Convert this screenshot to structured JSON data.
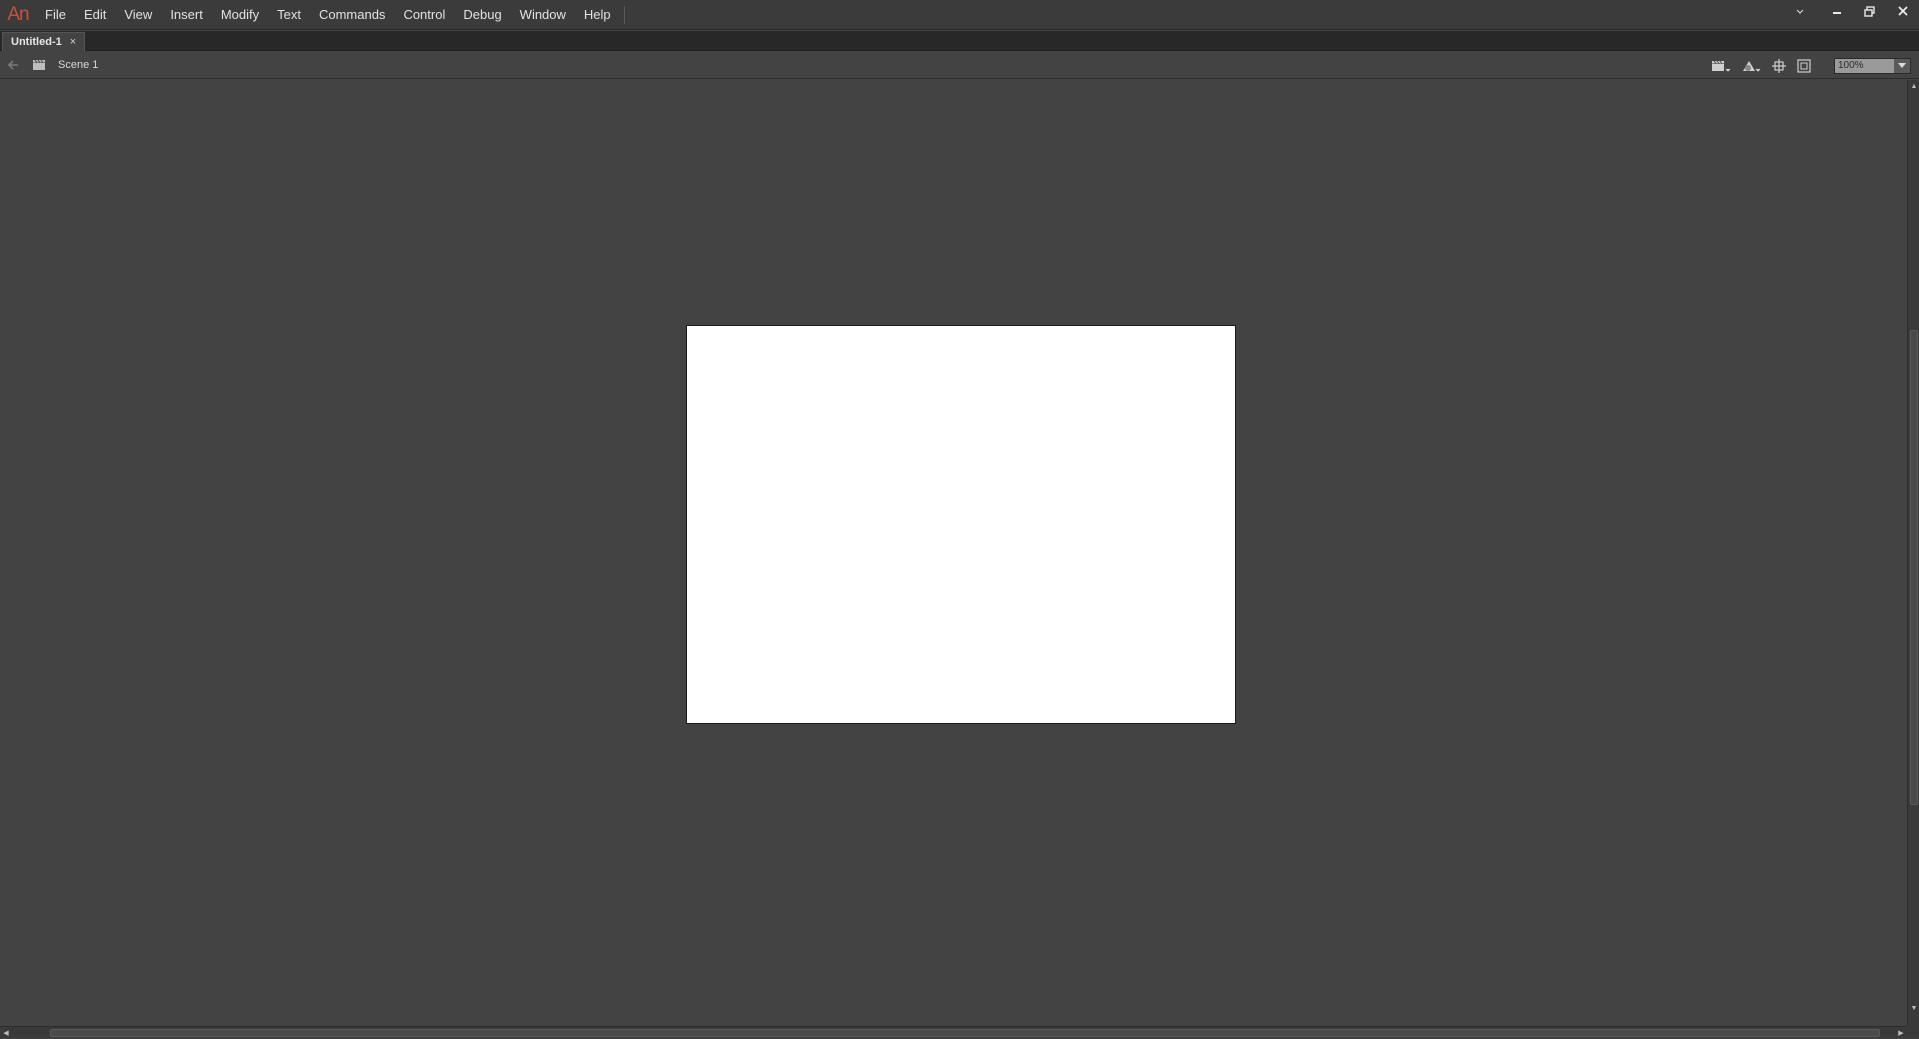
{
  "app": {
    "logo_text": "An",
    "logo_color": "#c8503c"
  },
  "menu": {
    "items": [
      "File",
      "Edit",
      "View",
      "Insert",
      "Modify",
      "Text",
      "Commands",
      "Control",
      "Debug",
      "Window",
      "Help"
    ]
  },
  "window_controls": {
    "dropdown_icon": "chevron-down-icon",
    "minimize_icon": "minimize-icon",
    "restore_icon": "restore-icon",
    "close_icon": "close-icon"
  },
  "tabs": [
    {
      "label": "Untitled-1",
      "close_glyph": "×",
      "active": true
    }
  ],
  "editbar": {
    "scene_label": "Scene 1",
    "zoom_value": "100%"
  },
  "stage": {
    "background": "#ffffff",
    "pasteboard": "#434343"
  }
}
